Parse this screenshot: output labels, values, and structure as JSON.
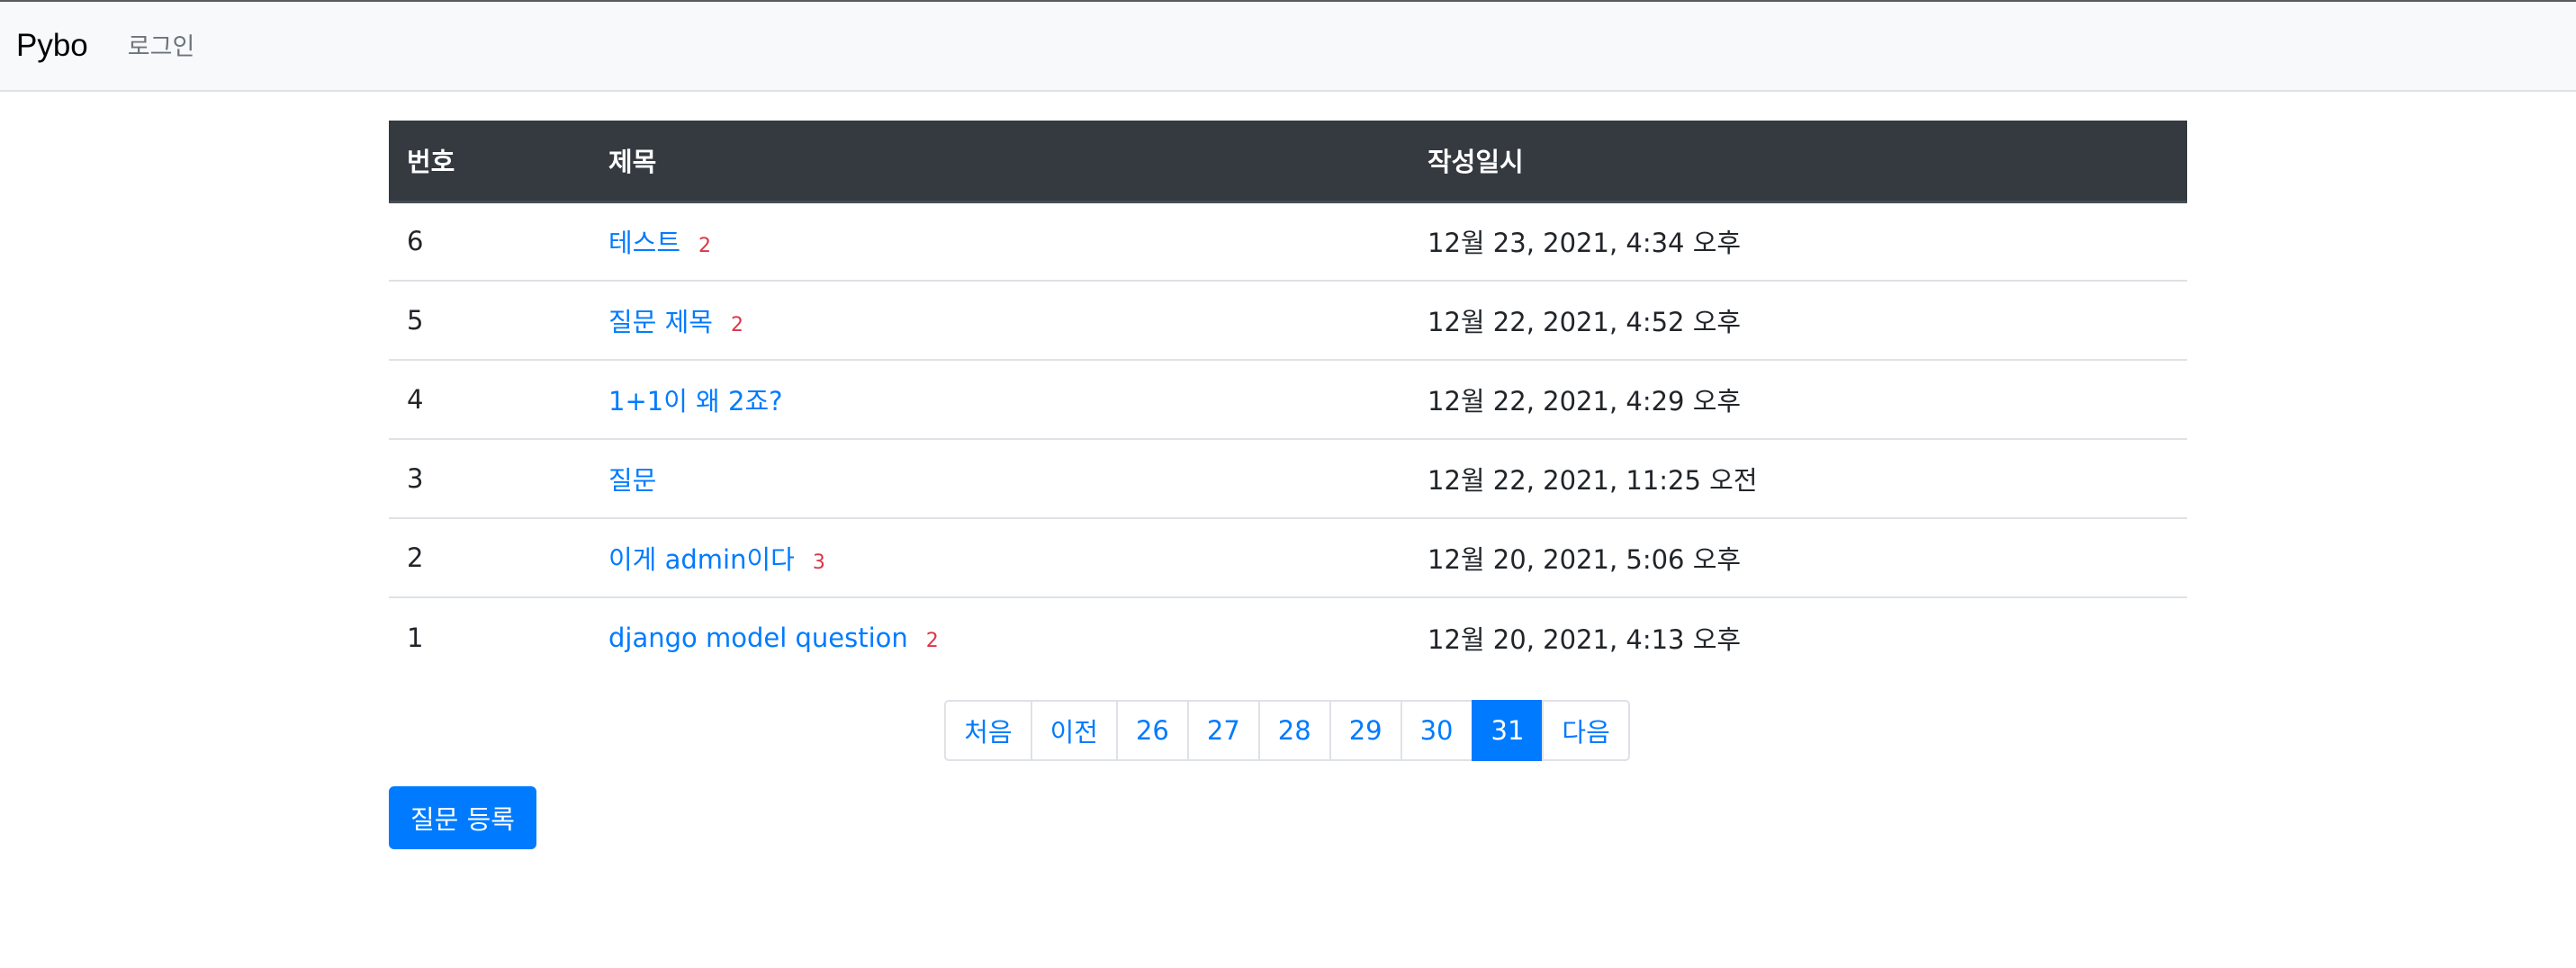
{
  "navbar": {
    "brand": "Pybo",
    "login_label": "로그인"
  },
  "table": {
    "headers": [
      "번호",
      "제목",
      "작성일시"
    ],
    "rows": [
      {
        "num": "6",
        "subject": "테스트",
        "answers": "2",
        "date": "12월 23, 2021, 4:34 오후"
      },
      {
        "num": "5",
        "subject": "질문 제목",
        "answers": "2",
        "date": "12월 22, 2021, 4:52 오후"
      },
      {
        "num": "4",
        "subject": "1+1이 왜 2죠?",
        "answers": "",
        "date": "12월 22, 2021, 4:29 오후"
      },
      {
        "num": "3",
        "subject": "질문",
        "answers": "",
        "date": "12월 22, 2021, 11:25 오전"
      },
      {
        "num": "2",
        "subject": "이게 admin이다",
        "answers": "3",
        "date": "12월 20, 2021, 5:06 오후"
      },
      {
        "num": "1",
        "subject": "django model question",
        "answers": "2",
        "date": "12월 20, 2021, 4:13 오후"
      }
    ]
  },
  "pagination": {
    "first": "처음",
    "prev": "이전",
    "pages": [
      "26",
      "27",
      "28",
      "29",
      "30",
      "31"
    ],
    "active_page": "31",
    "next": "다음"
  },
  "actions": {
    "create_question": "질문 등록"
  },
  "colors": {
    "primary": "#007bff",
    "danger": "#dc3545",
    "table_header": "#343a40"
  }
}
